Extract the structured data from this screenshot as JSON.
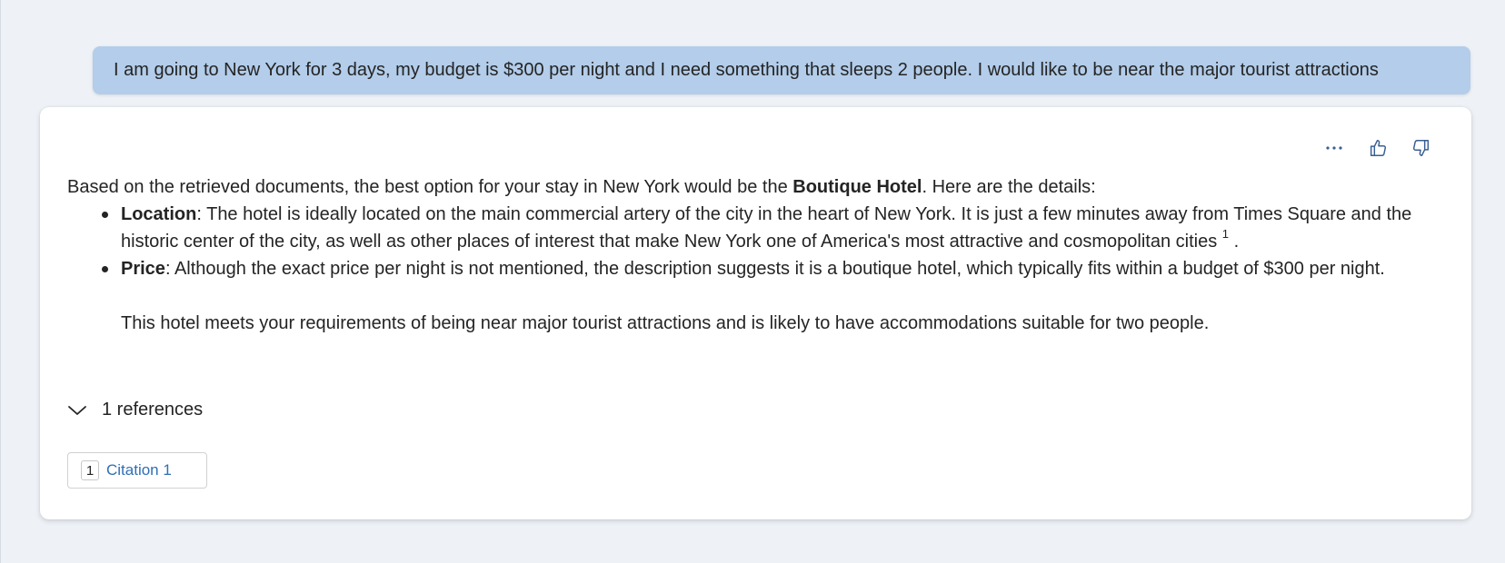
{
  "user_message": "I am going to New York for 3 days, my budget is $300 per night and I need something that sleeps 2 people. I would like to be near the major tourist attractions",
  "actions": {
    "more_icon": "more-horizontal-icon",
    "like_icon": "thumbs-up-icon",
    "dislike_icon": "thumbs-down-icon"
  },
  "answer": {
    "intro_prefix": "Based on the retrieved documents, the best option for your stay in New York would be the ",
    "intro_bold": "Boutique Hotel",
    "intro_suffix": ". Here are the details:",
    "bullets": [
      {
        "label": "Location",
        "text": ": The hotel is ideally located on the main commercial artery of the city in the heart of New York. It is just a few minutes away from Times Square and the historic center of the city, as well as other places of interest that make New York one of America's most attractive and cosmopolitan cities ",
        "sup": "1",
        "tail": "."
      },
      {
        "label": "Price",
        "text": ": Although the exact price per night is not mentioned, the description suggests it is a boutique hotel, which typically fits within a budget of $300 per night."
      }
    ],
    "closing": "This hotel meets your requirements of being near major tourist attractions and is likely to have accommodations suitable for two people."
  },
  "references": {
    "toggle_label": "1 references",
    "citations": [
      {
        "number": "1",
        "label": "Citation 1"
      }
    ]
  },
  "colors": {
    "user_bubble": "#b3cdea",
    "citation_link": "#2f6fb7",
    "background": "#eef2f7"
  }
}
